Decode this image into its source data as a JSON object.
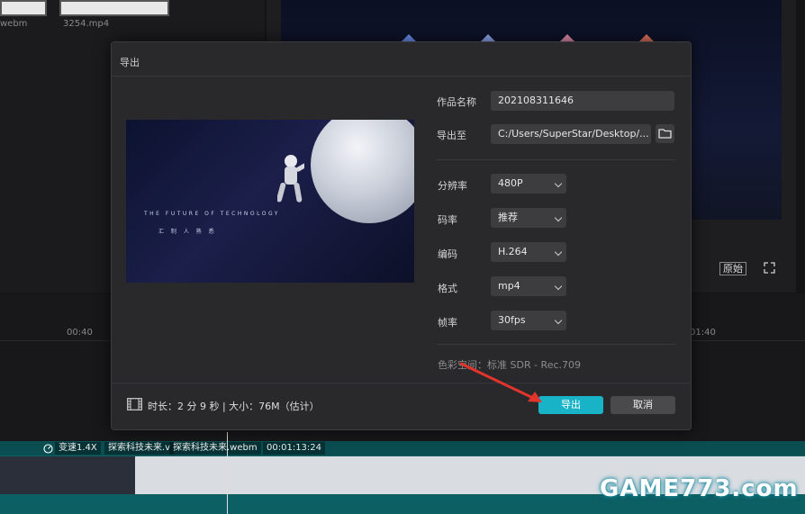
{
  "media": {
    "files": [
      {
        "label": "webm"
      },
      {
        "label": "3254.mp4"
      }
    ]
  },
  "preview": {
    "original_label": "原始"
  },
  "timeline": {
    "ticks": [
      "00:40",
      "01:40"
    ],
    "clip": {
      "speed_label": "变速1.4X",
      "name_short": "探索科技未来.v",
      "name": "探索科技未来.webm",
      "duration": "00:01:13:24"
    }
  },
  "dialog": {
    "title": "导出",
    "image_text_line1": "THE FUTURE OF TECHNOLOGY",
    "image_text_line2": "汇 制 人 熟 悉",
    "fields": {
      "name_label": "作品名称",
      "name_value": "202108311646",
      "path_label": "导出至",
      "path_value": "C:/Users/SuperStar/Desktop/..."
    },
    "settings": [
      {
        "label": "分辨率",
        "value": "480P"
      },
      {
        "label": "码率",
        "value": "推荐"
      },
      {
        "label": "编码",
        "value": "H.264"
      },
      {
        "label": "格式",
        "value": "mp4"
      },
      {
        "label": "帧率",
        "value": "30fps"
      }
    ],
    "color_space": "色彩空间：标准 SDR - Rec.709",
    "footer_info": "时长：2 分 9 秒 | 大小：76M（估计）",
    "export_button": "导出",
    "cancel_button": "取消"
  },
  "watermark": "GAME773.com",
  "colors": {
    "accent": "#18b3c6",
    "annotation_arrow": "#e0342c",
    "track": "#0c5f63"
  }
}
